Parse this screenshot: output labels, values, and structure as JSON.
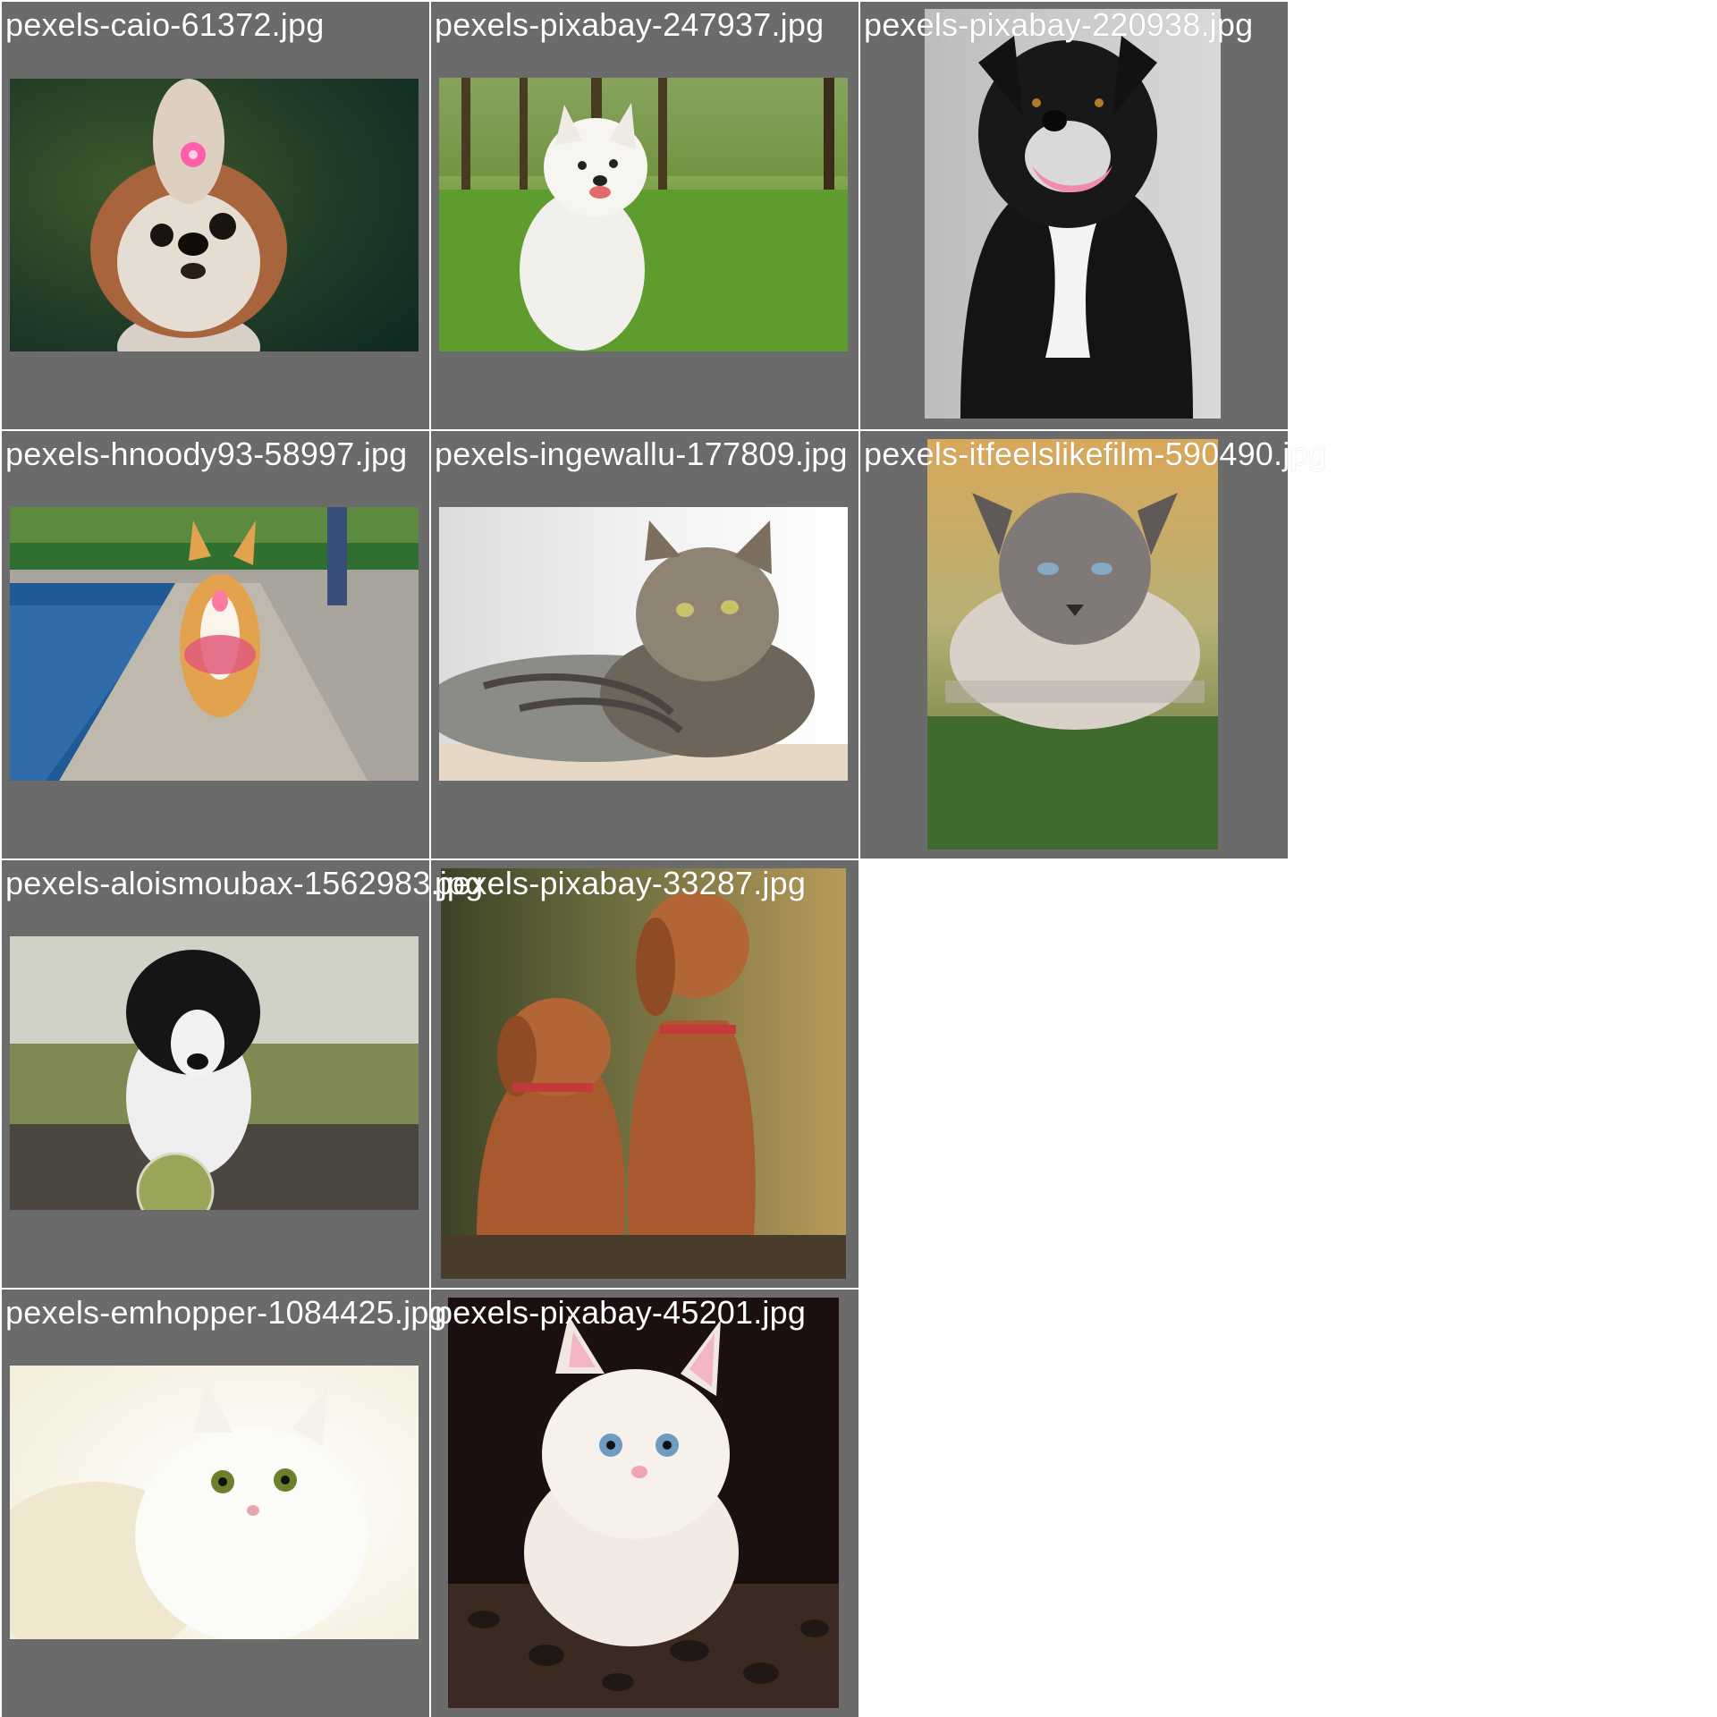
{
  "gallery": {
    "tiles": [
      {
        "filename": "pexels-caio-61372.jpg",
        "subject": "shih-tzu-dog"
      },
      {
        "filename": "pexels-pixabay-247937.jpg",
        "subject": "white-puppy-on-grass"
      },
      {
        "filename": "pexels-pixabay-220938.jpg",
        "subject": "black-dog-portrait"
      },
      {
        "filename": "pexels-hnoody93-58997.jpg",
        "subject": "corgi-walking"
      },
      {
        "filename": "pexels-ingewallu-177809.jpg",
        "subject": "tabby-cat-lying"
      },
      {
        "filename": "pexels-itfeelslikefilm-590490.jpg",
        "subject": "siamese-cat-on-grass"
      },
      {
        "filename": "pexels-aloismoubax-1562983.jpg",
        "subject": "border-collie-with-ball"
      },
      {
        "filename": "pexels-pixabay-33287.jpg",
        "subject": "two-vizsla-dogs"
      },
      {
        "filename": "pexels-emhopper-1084425.jpg",
        "subject": "white-cat"
      },
      {
        "filename": "pexels-pixabay-45201.jpg",
        "subject": "white-kitten"
      }
    ],
    "tile_background": "#6b6b6b",
    "label_color": "#ffffff"
  }
}
